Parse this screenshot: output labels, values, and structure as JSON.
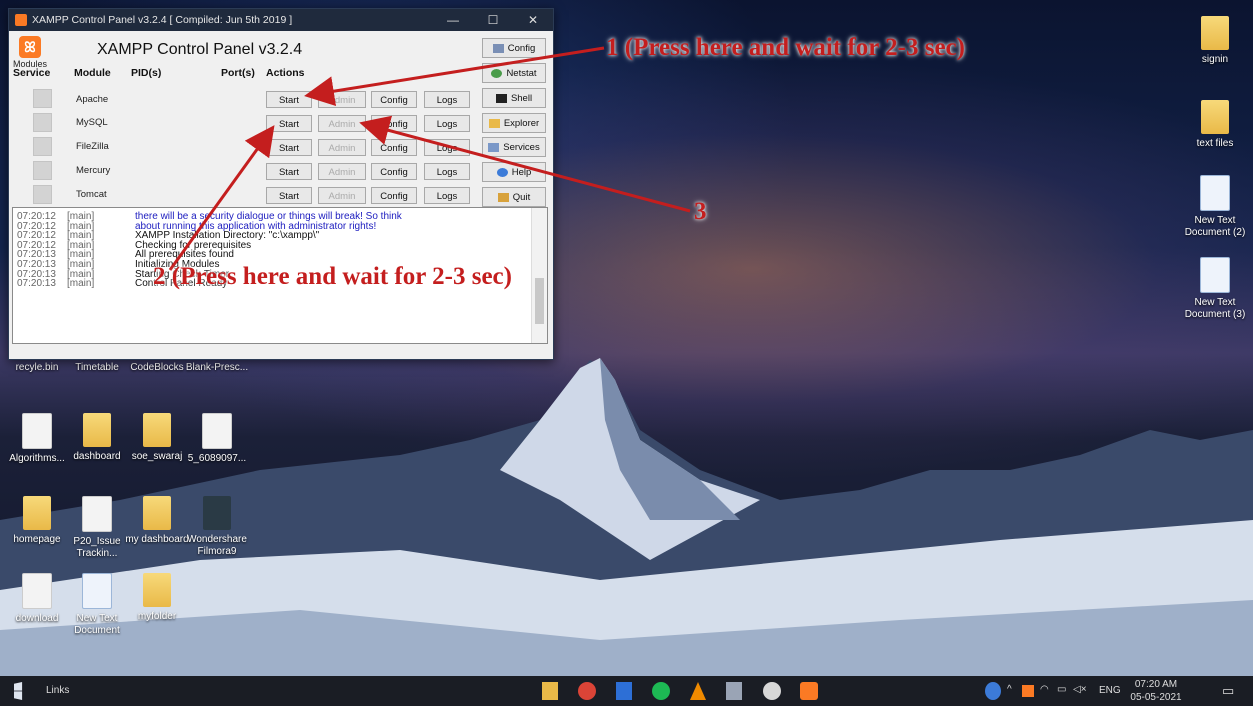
{
  "window": {
    "title": "XAMPP Control Panel v3.2.4   [ Compiled: Jun 5th 2019 ]",
    "minimize": "—",
    "maximize": "☐",
    "close": "✕"
  },
  "panel": {
    "heading": "XAMPP Control Panel v3.2.4",
    "modules_label": "Modules",
    "col_service": "Service",
    "col_module": "Module",
    "col_pids": "PID(s)",
    "col_ports": "Port(s)",
    "col_actions": "Actions",
    "modules": [
      {
        "name": "Apache",
        "start": "Start",
        "admin": "Admin",
        "config": "Config",
        "logs": "Logs"
      },
      {
        "name": "MySQL",
        "start": "Start",
        "admin": "Admin",
        "config": "Config",
        "logs": "Logs"
      },
      {
        "name": "FileZilla",
        "start": "Start",
        "admin": "Admin",
        "config": "Config",
        "logs": "Logs"
      },
      {
        "name": "Mercury",
        "start": "Start",
        "admin": "Admin",
        "config": "Config",
        "logs": "Logs"
      },
      {
        "name": "Tomcat",
        "start": "Start",
        "admin": "Admin",
        "config": "Config",
        "logs": "Logs"
      }
    ],
    "side_buttons": [
      "Config",
      "Netstat",
      "Shell",
      "Explorer",
      "Services",
      "Help",
      "Quit"
    ]
  },
  "log": [
    {
      "time": "07:20:12",
      "module": "[main]",
      "msg": "there will be a security dialogue or things will break! So think",
      "blue": true
    },
    {
      "time": "07:20:12",
      "module": "[main]",
      "msg": "about running this application with administrator rights!",
      "blue": true
    },
    {
      "time": "07:20:12",
      "module": "[main]",
      "msg": "XAMPP Installation Directory: \"c:\\xampp\\\"",
      "blue": false
    },
    {
      "time": "07:20:12",
      "module": "[main]",
      "msg": "Checking for prerequisites",
      "blue": false
    },
    {
      "time": "07:20:13",
      "module": "[main]",
      "msg": "All prerequisites found",
      "blue": false
    },
    {
      "time": "07:20:13",
      "module": "[main]",
      "msg": "Initializing Modules",
      "blue": false
    },
    {
      "time": "07:20:13",
      "module": "[main]",
      "msg": "Starting Check-Timer",
      "blue": false
    },
    {
      "time": "07:20:13",
      "module": "[main]",
      "msg": "Control Panel Ready",
      "blue": false
    }
  ],
  "annotations": {
    "a1": "1 (Press here and wait for 2-3 sec)",
    "a2": "2 (Press here and wait for 2-3 sec)",
    "a3": "3"
  },
  "desktop": {
    "left": [
      "recyle.bin",
      "Timetable",
      "CodeBlocks",
      "Blank-Presc...",
      "Algorithms...",
      "dashboard",
      "soe_swaraj",
      "5_6089097...",
      "homepage",
      "P20_Issue Trackin...",
      "my dashboard",
      "Wondershare Filmora9",
      "download",
      "New Text Document",
      "myfolder"
    ],
    "right": [
      "signin",
      "text files",
      "New Text Document (2)",
      "New Text Document (3)"
    ]
  },
  "taskbar": {
    "links": "Links",
    "language": "ENG",
    "time": "07:20 AM",
    "date": "05-05-2021"
  }
}
